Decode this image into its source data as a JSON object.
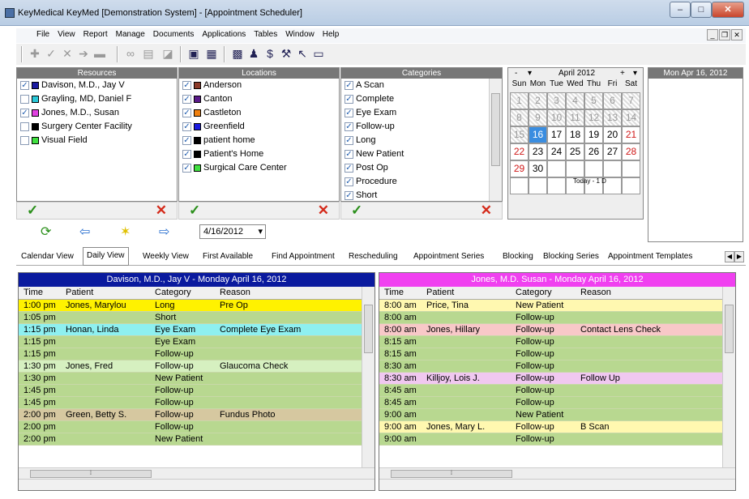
{
  "window": {
    "title": "KeyMedical KeyMed [Demonstration System] - [Appointment Scheduler]"
  },
  "menu": [
    "File",
    "View",
    "Report",
    "Manage",
    "Documents",
    "Applications",
    "Tables",
    "Window",
    "Help"
  ],
  "panels": {
    "resources": {
      "header": "Resources",
      "items": [
        {
          "label": "Davison, M.D., Jay V",
          "checked": true,
          "color": "#1a1aa0"
        },
        {
          "label": "Grayling, MD, Daniel F",
          "checked": false,
          "color": "#2ac8d8"
        },
        {
          "label": "Jones, M.D., Susan",
          "checked": true,
          "color": "#e040e0"
        },
        {
          "label": "Surgery Center Facility",
          "checked": false,
          "color": "#000000"
        },
        {
          "label": "Visual Field",
          "checked": false,
          "color": "#40e040"
        }
      ]
    },
    "locations": {
      "header": "Locations",
      "items": [
        {
          "label": "Anderson",
          "checked": true,
          "color": "#8b3a2a"
        },
        {
          "label": "Canton",
          "checked": true,
          "color": "#5a1a8a"
        },
        {
          "label": "Castleton",
          "checked": true,
          "color": "#f08010"
        },
        {
          "label": "Greenfield",
          "checked": true,
          "color": "#1a1ae0"
        },
        {
          "label": "patient home",
          "checked": true,
          "color": "#000000"
        },
        {
          "label": "Patient's Home",
          "checked": true,
          "color": "#000000"
        },
        {
          "label": "Surgical Care Center",
          "checked": true,
          "color": "#40e040"
        }
      ]
    },
    "categories": {
      "header": "Categories",
      "items": [
        {
          "label": "A Scan",
          "checked": true
        },
        {
          "label": "Complete",
          "checked": true
        },
        {
          "label": "Eye Exam",
          "checked": true
        },
        {
          "label": "Follow-up",
          "checked": true
        },
        {
          "label": "Long",
          "checked": true
        },
        {
          "label": "New Patient",
          "checked": true
        },
        {
          "label": "Post Op",
          "checked": true
        },
        {
          "label": "Procedure",
          "checked": true
        },
        {
          "label": "Short",
          "checked": true
        }
      ]
    }
  },
  "calendar": {
    "month_label": "April 2012",
    "prev": "-",
    "next": "+",
    "dow": [
      "Sun",
      "Mon",
      "Tue",
      "Wed",
      "Thu",
      "Fri",
      "Sat"
    ],
    "weeks": [
      [
        "1",
        "2",
        "3",
        "4",
        "5",
        "6",
        "7"
      ],
      [
        "8",
        "9",
        "10",
        "11",
        "12",
        "13",
        "14"
      ],
      [
        "15",
        "16",
        "17",
        "18",
        "19",
        "20",
        "21"
      ],
      [
        "22",
        "23",
        "24",
        "25",
        "26",
        "27",
        "28"
      ],
      [
        "29",
        "30",
        "",
        "",
        "",
        "",
        ""
      ],
      [
        "",
        "",
        "",
        "",
        "",
        "",
        ""
      ]
    ],
    "today_label": "Today - 1 D"
  },
  "date_panel_title": "Mon Apr 16, 2012",
  "date_field": "4/16/2012",
  "tabs": [
    "Calendar View",
    "Daily View",
    "Weekly View",
    "First Available",
    "Find Appointment",
    "Rescheduling",
    "Appointment Series",
    "Blocking",
    "Blocking Series",
    "Appointment Templates"
  ],
  "active_tab": "Daily View",
  "schedules": [
    {
      "title": "Davison, M.D., Jay V - Monday  April 16, 2012",
      "header_color": "#0a1a9e",
      "columns": [
        "Time",
        "Patient",
        "Category",
        "Reason"
      ],
      "rows": [
        {
          "time": "1:00 pm",
          "patient": "Jones, Marylou",
          "category": "Long",
          "reason": "Pre Op",
          "color": "#fff200"
        },
        {
          "time": "1:05 pm",
          "patient": "",
          "category": "Short",
          "reason": "",
          "color": "#b8d890"
        },
        {
          "time": "1:15 pm",
          "patient": "Honan, Linda",
          "category": "Eye Exam",
          "reason": "Complete Eye Exam",
          "color": "#8ef0f0"
        },
        {
          "time": "1:15 pm",
          "patient": "",
          "category": "Eye Exam",
          "reason": "",
          "color": "#b8d890"
        },
        {
          "time": "1:15 pm",
          "patient": "",
          "category": "Follow-up",
          "reason": "",
          "color": "#b8d890"
        },
        {
          "time": "1:30 pm",
          "patient": "Jones, Fred",
          "category": "Follow-up",
          "reason": "Glaucoma Check",
          "color": "#d6f0c0"
        },
        {
          "time": "1:30 pm",
          "patient": "",
          "category": "New Patient",
          "reason": "",
          "color": "#b8d890"
        },
        {
          "time": "1:45 pm",
          "patient": "",
          "category": "Follow-up",
          "reason": "",
          "color": "#b8d890"
        },
        {
          "time": "1:45 pm",
          "patient": "",
          "category": "Follow-up",
          "reason": "",
          "color": "#b8d890"
        },
        {
          "time": "2:00 pm",
          "patient": "Green, Betty S.",
          "category": "Follow-up",
          "reason": "Fundus Photo",
          "color": "#d6c8a0"
        },
        {
          "time": "2:00 pm",
          "patient": "",
          "category": "Follow-up",
          "reason": "",
          "color": "#b8d890"
        },
        {
          "time": "2:00 pm",
          "patient": "",
          "category": "New Patient",
          "reason": "",
          "color": "#b8d890"
        }
      ]
    },
    {
      "title": "Jones, M.D. Susan - Monday  April 16, 2012",
      "header_color": "#f040f0",
      "columns": [
        "Time",
        "Patient",
        "Category",
        "Reason"
      ],
      "rows": [
        {
          "time": "8:00 am",
          "patient": "Price, Tina",
          "category": "New Patient",
          "reason": "",
          "color": "#fff8b0"
        },
        {
          "time": "8:00 am",
          "patient": "",
          "category": "Follow-up",
          "reason": "",
          "color": "#b8d890"
        },
        {
          "time": "8:00 am",
          "patient": "Jones, Hillary",
          "category": "Follow-up",
          "reason": "Contact Lens Check",
          "color": "#f8c8c8"
        },
        {
          "time": "8:15 am",
          "patient": "",
          "category": "Follow-up",
          "reason": "",
          "color": "#b8d890"
        },
        {
          "time": "8:15 am",
          "patient": "",
          "category": "Follow-up",
          "reason": "",
          "color": "#b8d890"
        },
        {
          "time": "8:30 am",
          "patient": "",
          "category": "Follow-up",
          "reason": "",
          "color": "#b8d890"
        },
        {
          "time": "8:30 am",
          "patient": "Killjoy, Lois J.",
          "category": "Follow-up",
          "reason": "Follow Up",
          "color": "#f0c8f0"
        },
        {
          "time": "8:45 am",
          "patient": "",
          "category": "Follow-up",
          "reason": "",
          "color": "#b8d890"
        },
        {
          "time": "8:45 am",
          "patient": "",
          "category": "Follow-up",
          "reason": "",
          "color": "#b8d890"
        },
        {
          "time": "9:00 am",
          "patient": "",
          "category": "New Patient",
          "reason": "",
          "color": "#b8d890"
        },
        {
          "time": "9:00 am",
          "patient": "Jones, Mary L.",
          "category": "Follow-up",
          "reason": "B Scan",
          "color": "#fff8b0"
        },
        {
          "time": "9:00 am",
          "patient": "",
          "category": "Follow-up",
          "reason": "",
          "color": "#b8d890"
        }
      ]
    }
  ]
}
